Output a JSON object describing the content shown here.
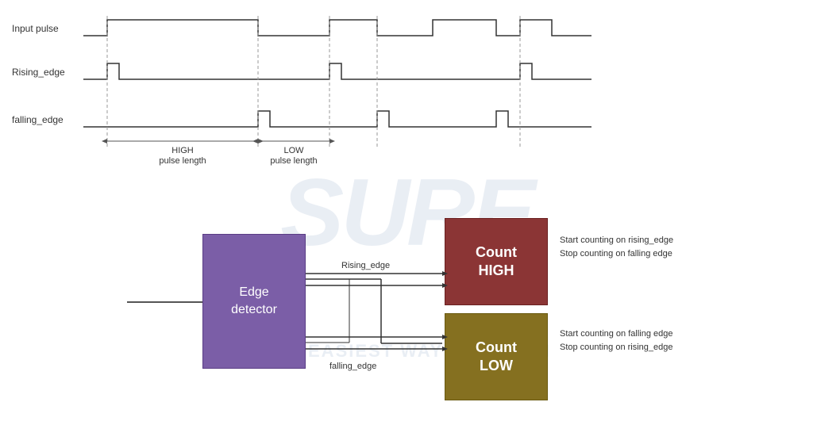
{
  "watermark": {
    "text": "SURE",
    "subtext": "THE EASIEST WAY TO LEARN"
  },
  "signals": [
    {
      "label": "Input pulse",
      "row": 0
    },
    {
      "label": "Rising_edge",
      "row": 1
    },
    {
      "label": "falling_edge",
      "row": 2
    }
  ],
  "annotations": {
    "high_pulse": "HIGH\npulse length",
    "low_pulse": "LOW\npulse length"
  },
  "blocks": {
    "edge_detector": "Edge\ndetector",
    "count_high": "Count\nHIGH",
    "count_low": "Count\nLOW",
    "rising_edge_label": "Rising_edge",
    "falling_edge_label": "falling_edge",
    "count_high_desc1": "Start counting on rising_edge",
    "count_high_desc2": "Stop counting on falling edge",
    "count_low_desc1": "Start counting on falling edge",
    "count_low_desc2": "Stop counting on rising_edge"
  }
}
